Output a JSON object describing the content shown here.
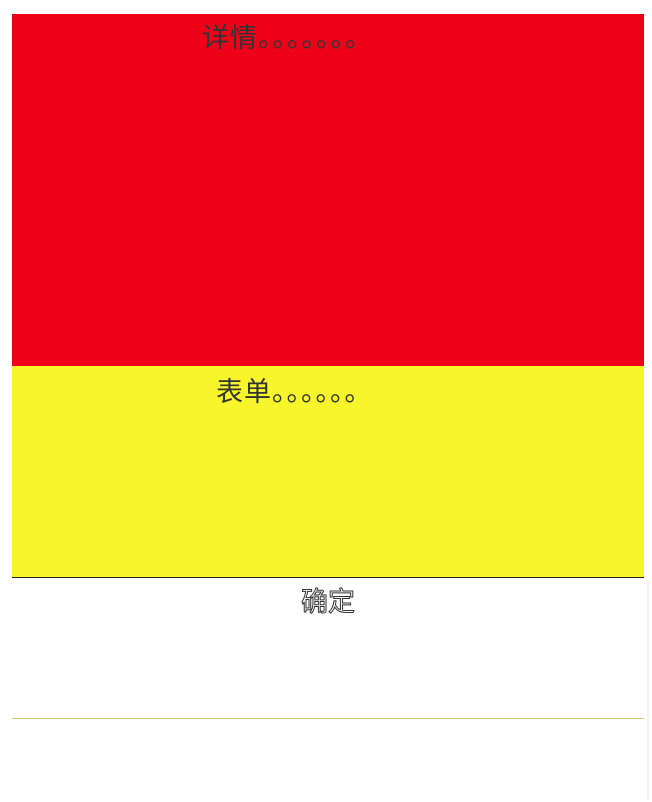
{
  "details": {
    "text": "详情。。。。。。。"
  },
  "form": {
    "text": "表单。。。。。。"
  },
  "confirm": {
    "label": "确定"
  },
  "colors": {
    "details_bg": "#ee0019",
    "form_bg": "#f6f62a",
    "text": "#333333"
  }
}
